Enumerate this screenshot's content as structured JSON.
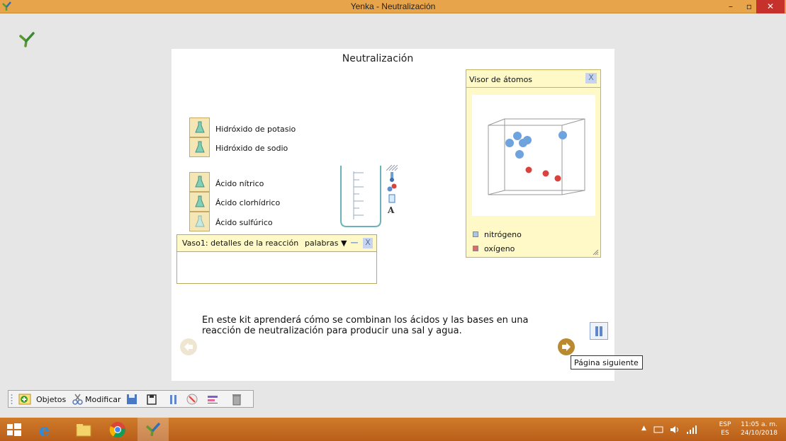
{
  "window": {
    "title": "Yenka - Neutralización",
    "minimize": "–",
    "maximize": "▫",
    "close": "✕"
  },
  "page": {
    "title": "Neutralización",
    "bases": [
      {
        "label": "Hidróxido de potasio"
      },
      {
        "label": "Hidróxido de sodio"
      }
    ],
    "acids": [
      {
        "label": "Ácido nítrico"
      },
      {
        "label": "Ácido clorhídrico"
      },
      {
        "label": "Ácido sulfúrico"
      }
    ],
    "details_panel": {
      "title": "Vaso1: detalles de la reacción",
      "mode": "palabras ▼",
      "minimize": "—",
      "close": "X"
    },
    "atom_viewer": {
      "title": "Visor de átomos",
      "close": "X",
      "legend": [
        {
          "label": "nitrógeno",
          "color": "#a7c7ea"
        },
        {
          "label": "oxígeno",
          "color": "#e06a6a"
        }
      ],
      "colors": {
        "nitrogen": "#6fa3de",
        "oxygen": "#d9433e"
      }
    },
    "description": "En este kit aprenderá cómo se combinan los ácidos y las bases en una reacción de neutralización para producir una sal y agua.",
    "tooltip": "Página siguiente",
    "beaker_tool_letter": "A"
  },
  "toolbar": {
    "objects_label": "Objetos",
    "modify_label": "Modificar"
  },
  "taskbar": {
    "lang_top": "ESP",
    "lang_bottom": "ES",
    "time": "11:05 a. m.",
    "date": "24/10/2018",
    "tray_arrow": "▲"
  }
}
